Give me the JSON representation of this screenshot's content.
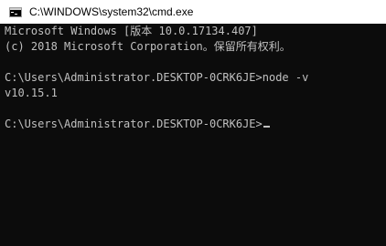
{
  "window": {
    "title": "C:\\WINDOWS\\system32\\cmd.exe",
    "icon": "cmd-icon"
  },
  "console": {
    "lines": [
      "Microsoft Windows [版本 10.0.17134.407]",
      "(c) 2018 Microsoft Corporation。保留所有权利。",
      "",
      "C:\\Users\\Administrator.DESKTOP-0CRK6JE>node -v",
      "v10.15.1",
      "",
      "C:\\Users\\Administrator.DESKTOP-0CRK6JE>"
    ]
  },
  "colors": {
    "console_bg": "#0c0c0c",
    "console_text": "#c0c0c0",
    "titlebar_bg": "#ffffff"
  }
}
